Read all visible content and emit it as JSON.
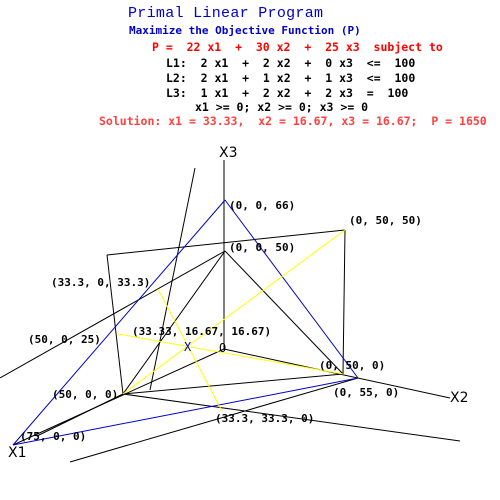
{
  "title": "Primal Linear Program",
  "subtitle": "Maximize the Objective Function (P)",
  "objective": "P =  22 x1  +  30 x2  +  25 x3  subject to",
  "constraints": [
    "L1:  2 x1  +  2 x2  +  0 x3  <=  100",
    "L2:  2 x1  +  1 x2  +  1 x3  <=  100",
    "L3:  1 x1  +  2 x2  +  2 x3  =  100",
    "x1 >= 0; x2 >= 0; x3 >= 0"
  ],
  "solution": "Solution: x1 = 33.33,  x2 = 16.67, x3 = 16.67;  P = 1650",
  "axes": {
    "x1": "X1",
    "x2": "X2",
    "x3": "X3",
    "origin": "O"
  },
  "solution_marker": "X",
  "point_labels": {
    "p_0_0_66": "(0, 0, 66)",
    "p_0_50_50": "(0, 50, 50)",
    "p_0_0_50": "(0, 0, 50)",
    "p_333_0_333": "(33.3, 0, 33.3)",
    "p_50_0_25": "(50, 0, 25)",
    "p_sol": "(33.33, 16.67, 16.67)",
    "p_0_50_0": "(0, 50, 0)",
    "p_50_0_0": "(50, 0, 0)",
    "p_0_55_0": "(0, 55, 0)",
    "p_333_333_0": "(33.3, 33.3, 0)",
    "p_75_0_0": "(75, 0, 0)"
  },
  "colors": {
    "title": "#0000cc",
    "objective": "#ff0000",
    "solution": "#ff4040",
    "plane_l1": "#000000",
    "plane_l2": "#0000cc",
    "plane_l3": "#ffff00"
  }
}
